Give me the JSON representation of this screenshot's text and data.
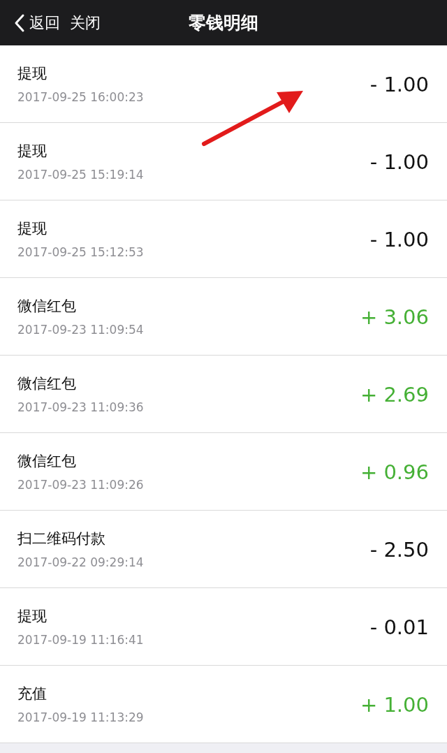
{
  "nav": {
    "back": "返回",
    "close": "关闭",
    "title": "零钱明细"
  },
  "rows": [
    {
      "title": "提现",
      "time": "2017-09-25 16:00:23",
      "amount": "- 1.00",
      "kind": "expense"
    },
    {
      "title": "提现",
      "time": "2017-09-25 15:19:14",
      "amount": "- 1.00",
      "kind": "expense"
    },
    {
      "title": "提现",
      "time": "2017-09-25 15:12:53",
      "amount": "- 1.00",
      "kind": "expense"
    },
    {
      "title": "微信红包",
      "time": "2017-09-23 11:09:54",
      "amount": "+ 3.06",
      "kind": "income"
    },
    {
      "title": "微信红包",
      "time": "2017-09-23 11:09:36",
      "amount": "+ 2.69",
      "kind": "income"
    },
    {
      "title": "微信红包",
      "time": "2017-09-23 11:09:26",
      "amount": "+ 0.96",
      "kind": "income"
    },
    {
      "title": "扫二维码付款",
      "time": "2017-09-22 09:29:14",
      "amount": "- 2.50",
      "kind": "expense"
    },
    {
      "title": "提现",
      "time": "2017-09-19 11:16:41",
      "amount": "- 0.01",
      "kind": "expense"
    },
    {
      "title": "充值",
      "time": "2017-09-19 11:13:29",
      "amount": "+ 1.00",
      "kind": "income"
    }
  ]
}
